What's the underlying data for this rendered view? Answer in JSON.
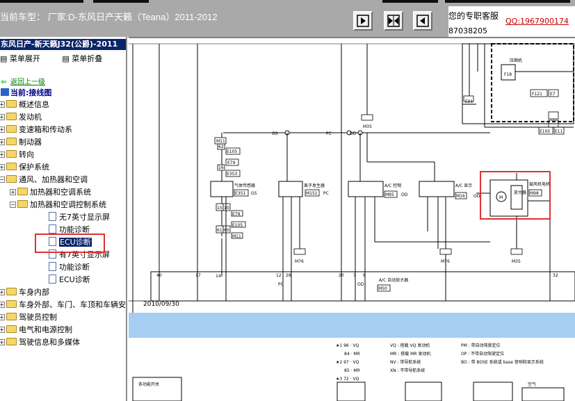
{
  "header": {
    "car_title": "当前车型：  厂家:D-东风日产天籁（Teana）2011-2012",
    "service_label": "您的专职客服",
    "service_qq": "QQ:1967900174",
    "service_number": "87038205"
  },
  "sidebar": {
    "title": "东风日产-新天籁J32(公爵)-2011",
    "expand_label": "菜单展开",
    "collapse_label": "菜单折叠",
    "back_label": "返回上一级",
    "current_label": "当前:接线图",
    "tree": [
      {
        "label": "概述信息",
        "type": "folder",
        "level": 0,
        "expanded": false
      },
      {
        "label": "发动机",
        "type": "folder",
        "level": 0,
        "expanded": false
      },
      {
        "label": "变速箱和传动系",
        "type": "folder",
        "level": 0,
        "expanded": false
      },
      {
        "label": "制动器",
        "type": "folder",
        "level": 0,
        "expanded": false
      },
      {
        "label": "转向",
        "type": "folder",
        "level": 0,
        "expanded": false
      },
      {
        "label": "保护系统",
        "type": "folder",
        "level": 0,
        "expanded": false
      },
      {
        "label": "通风、加热器和空调",
        "type": "folder",
        "level": 0,
        "expanded": true
      },
      {
        "label": "加热器和空调系统",
        "type": "folder",
        "level": 1,
        "expanded": false
      },
      {
        "label": "加热器和空调控制系统",
        "type": "folder",
        "level": 1,
        "expanded": true
      },
      {
        "label": "无7英寸显示屏",
        "type": "doc",
        "level": 2
      },
      {
        "label": "功能诊断",
        "type": "doc",
        "level": 2
      },
      {
        "label": "ECU诊断",
        "type": "doc",
        "level": 2,
        "selected": true
      },
      {
        "label": "有7英寸显示屏",
        "type": "doc",
        "level": 2
      },
      {
        "label": "功能诊断",
        "type": "doc",
        "level": 2
      },
      {
        "label": "ECU诊断",
        "type": "doc",
        "level": 2
      },
      {
        "label": "车身内部",
        "type": "folder",
        "level": 0,
        "expanded": false
      },
      {
        "label": "车身外部、车门、车顶和车辆安",
        "type": "folder",
        "level": 0,
        "expanded": false
      },
      {
        "label": "驾驶员控制",
        "type": "folder",
        "level": 0,
        "expanded": false
      },
      {
        "label": "电气和电源控制",
        "type": "folder",
        "level": 0,
        "expanded": false
      },
      {
        "label": "驾驶信息和多媒体",
        "type": "folder",
        "level": 0,
        "expanded": false
      }
    ]
  },
  "diagram": {
    "date": "2010/09/30",
    "labels": {
      "compressor": "压缩机",
      "sensor": "气体传感器",
      "ion": "离子发生器",
      "ac_control": "A/C 控制",
      "ac_display": "A/C 显示",
      "blower": "鼓风机电机",
      "amp": "放大器",
      "ac_amp": "A/C 自动放大器",
      "fan_switch": "条功能开关",
      "air": "空气"
    },
    "connectors": [
      "E21",
      "F18",
      "F121",
      "E7",
      "E105",
      "E11",
      "M35",
      "M11",
      "E105",
      "E79",
      "E353",
      "E351",
      "M151",
      "M95",
      "M16",
      "M98",
      "M76",
      "M76",
      "M35",
      "M50",
      "GS",
      "PC",
      "OD"
    ],
    "legend": [
      {
        "mark": "★1",
        "num": "96",
        "code": "VQ",
        "desc_code": "VQ",
        "desc": ": 搭载 VQ 发动机",
        "code2": "PM",
        "desc2": ": 带自动驾驶定位"
      },
      {
        "mark": "",
        "num": "84",
        "code": "MR",
        "desc_code": "MR",
        "desc": ": 搭载 MR 发动机",
        "code2": "OP",
        "desc2": ": 不带自动驾驶定位"
      },
      {
        "mark": "★2",
        "num": "97",
        "code": "VQ",
        "desc_code": "NV",
        "desc": ": 带导航系统",
        "code2": "BO",
        "desc2": ": 带 BOSE 系统或 base 音响和显示系统"
      },
      {
        "mark": "",
        "num": "85",
        "code": "MR",
        "desc_code": "XN",
        "desc": ": 不带导航系统",
        "code2": "",
        "desc2": ""
      },
      {
        "mark": "★3",
        "num": "72",
        "code": "VQ",
        "desc_code": "",
        "desc": "",
        "code2": "",
        "desc2": ""
      }
    ]
  }
}
